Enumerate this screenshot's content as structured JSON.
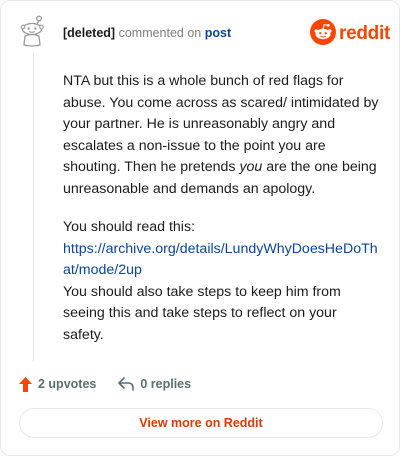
{
  "header": {
    "username": "[deleted]",
    "action_text": "commented on",
    "post_link": "post"
  },
  "logo": {
    "wordmark": "reddit",
    "icon": "reddit-snoo-icon",
    "brand_color": "#ff4500"
  },
  "avatar": {
    "icon": "deleted-user-snoo-icon"
  },
  "comment": {
    "paragraph1_a": "NTA but this is a whole bunch of red flags for abuse. You come across as scared/ intimidated by your partner. He is unreasonably angry and escalates a non-issue to the point you are shouting. Then he pretends ",
    "paragraph1_em": "you",
    "paragraph1_b": " are the one being unreasonable and demands an apology.",
    "read_intro": "You should read this:",
    "link": "https://archive.org/details/LundyWhyDoesHeDoThat/mode/2up",
    "paragraph3": "You should also take steps to keep him from seeing this and take steps to reflect on your safety."
  },
  "footer": {
    "upvotes": "2 upvotes",
    "replies": "0 replies",
    "upvote_icon": "upvote-arrow-icon",
    "reply_icon": "reply-arrow-icon"
  },
  "button": {
    "label": "View more on Reddit"
  },
  "colors": {
    "accent": "#ff4500",
    "link": "#0a449b",
    "meta": "#576f76",
    "button_text": "#d93a00"
  }
}
